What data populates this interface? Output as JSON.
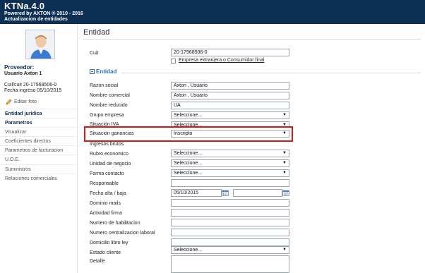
{
  "header": {
    "title": "KTNa.4.0",
    "powered": "Powered by AXTON ® 2010 - 2016",
    "subtitle": "Actualizacion de entidades"
  },
  "sidebar": {
    "provider_label": "Proveedor:",
    "user_name": "Usuario Axton 1",
    "cuit": "Cuil/cuit 20-17968506-0",
    "fecha_ingreso": "Fecha ingreso 05/10/2015",
    "edit_photo": "Editar foto",
    "nav": [
      {
        "label": "Entidad juridica",
        "bold": true
      },
      {
        "label": "Parametros",
        "bold": true
      },
      {
        "label": "Visualizar",
        "bold": false
      },
      {
        "label": "Coeficientes directos",
        "bold": false
      },
      {
        "label": "Parametros de facturacion",
        "bold": false
      },
      {
        "label": "U.O.E.",
        "bold": false
      },
      {
        "label": "Suministros",
        "bold": false
      },
      {
        "label": "Relaciones comerciales",
        "bold": false
      }
    ]
  },
  "main": {
    "title": "Entidad",
    "cuit_label": "Cuit",
    "cuit_value": "20-17968506-0",
    "extranjera_label": "Empresa extranjera o Consumidor final",
    "section_title": "Entidad",
    "fields": {
      "razon_social": {
        "label": "Razon social",
        "value": "Axton , Usuario"
      },
      "nombre_comercial": {
        "label": "Nombre comercial",
        "value": "Axton , Usuario"
      },
      "nombre_reducido": {
        "label": "Nombre reducido",
        "value": "UA"
      },
      "grupo_empresa": {
        "label": "Grupo empresa",
        "value": "Seleccione..."
      },
      "situacion_iva": {
        "label": "Situación IVA",
        "value": "Seleccione..."
      },
      "situacion_ganancias": {
        "label": "Situacion ganancias",
        "value": "Inscripto"
      },
      "ingresos_brutos": {
        "label": "Ingresos brutos",
        "value": ""
      },
      "rubro_economico": {
        "label": "Rubro economico",
        "value": "Seleccione..."
      },
      "unidad_negocio": {
        "label": "Unidad de negocio",
        "value": "Seleccione..."
      },
      "forma_contacto": {
        "label": "Forma contacto",
        "value": "Seleccione..."
      },
      "responsable": {
        "label": "Responsable",
        "value": ""
      },
      "fecha_alta_baja": {
        "label": "Fecha alta / baja",
        "value": "05/10/2015",
        "value2": ""
      },
      "dominio_mails": {
        "label": "Dominio mails",
        "value": ""
      },
      "actividad_firma": {
        "label": "Actividad firma",
        "value": ""
      },
      "numero_habilitacion": {
        "label": "Numero de habilitacion",
        "value": ""
      },
      "numero_centralizacion": {
        "label": "Numero centralizacion laboral",
        "value": ""
      },
      "domicilio_libro_ley": {
        "label": "Domicilio libro ley",
        "value": ""
      },
      "estado_cliente": {
        "label": "Estado cliente",
        "value": "Seleccione..."
      },
      "detalle": {
        "label": "Detalle",
        "value": ""
      }
    }
  },
  "colors": {
    "header_bg": "#0d2f54",
    "section_accent": "#2a6fb0",
    "highlight_border": "#d11a1a"
  },
  "icons": [
    "user-avatar-icon",
    "pencil-icon",
    "calendar-icon",
    "chevron-down-icon",
    "checkbox-icon"
  ]
}
